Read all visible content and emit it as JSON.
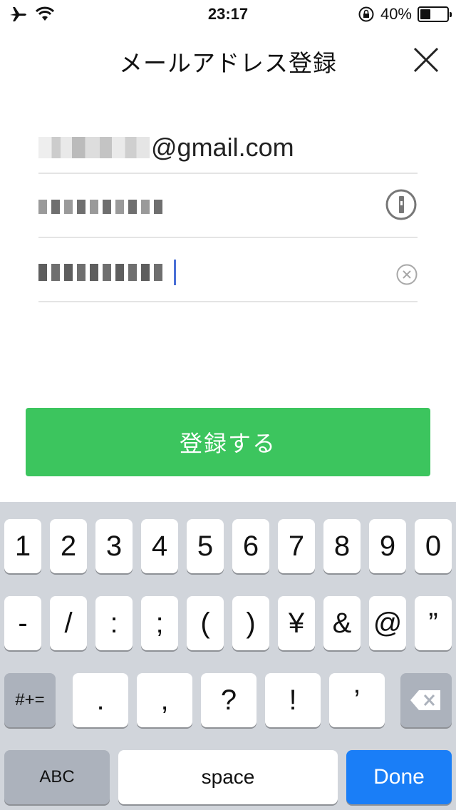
{
  "status": {
    "time": "23:17",
    "battery": "40%",
    "battery_level": 0.4
  },
  "header": {
    "title": "メールアドレス登録"
  },
  "form": {
    "email_suffix": "@gmail.com"
  },
  "register_button": {
    "label": "登録する"
  },
  "keyboard": {
    "row1": [
      "1",
      "2",
      "3",
      "4",
      "5",
      "6",
      "7",
      "8",
      "9",
      "0"
    ],
    "row2": [
      "-",
      "/",
      ":",
      ";",
      "(",
      ")",
      "¥",
      "&",
      "@",
      "”"
    ],
    "row3_left": "#+=",
    "row3": [
      ".",
      ",",
      "?",
      "!",
      "’"
    ],
    "abc": "ABC",
    "space": "space",
    "done": "Done"
  }
}
